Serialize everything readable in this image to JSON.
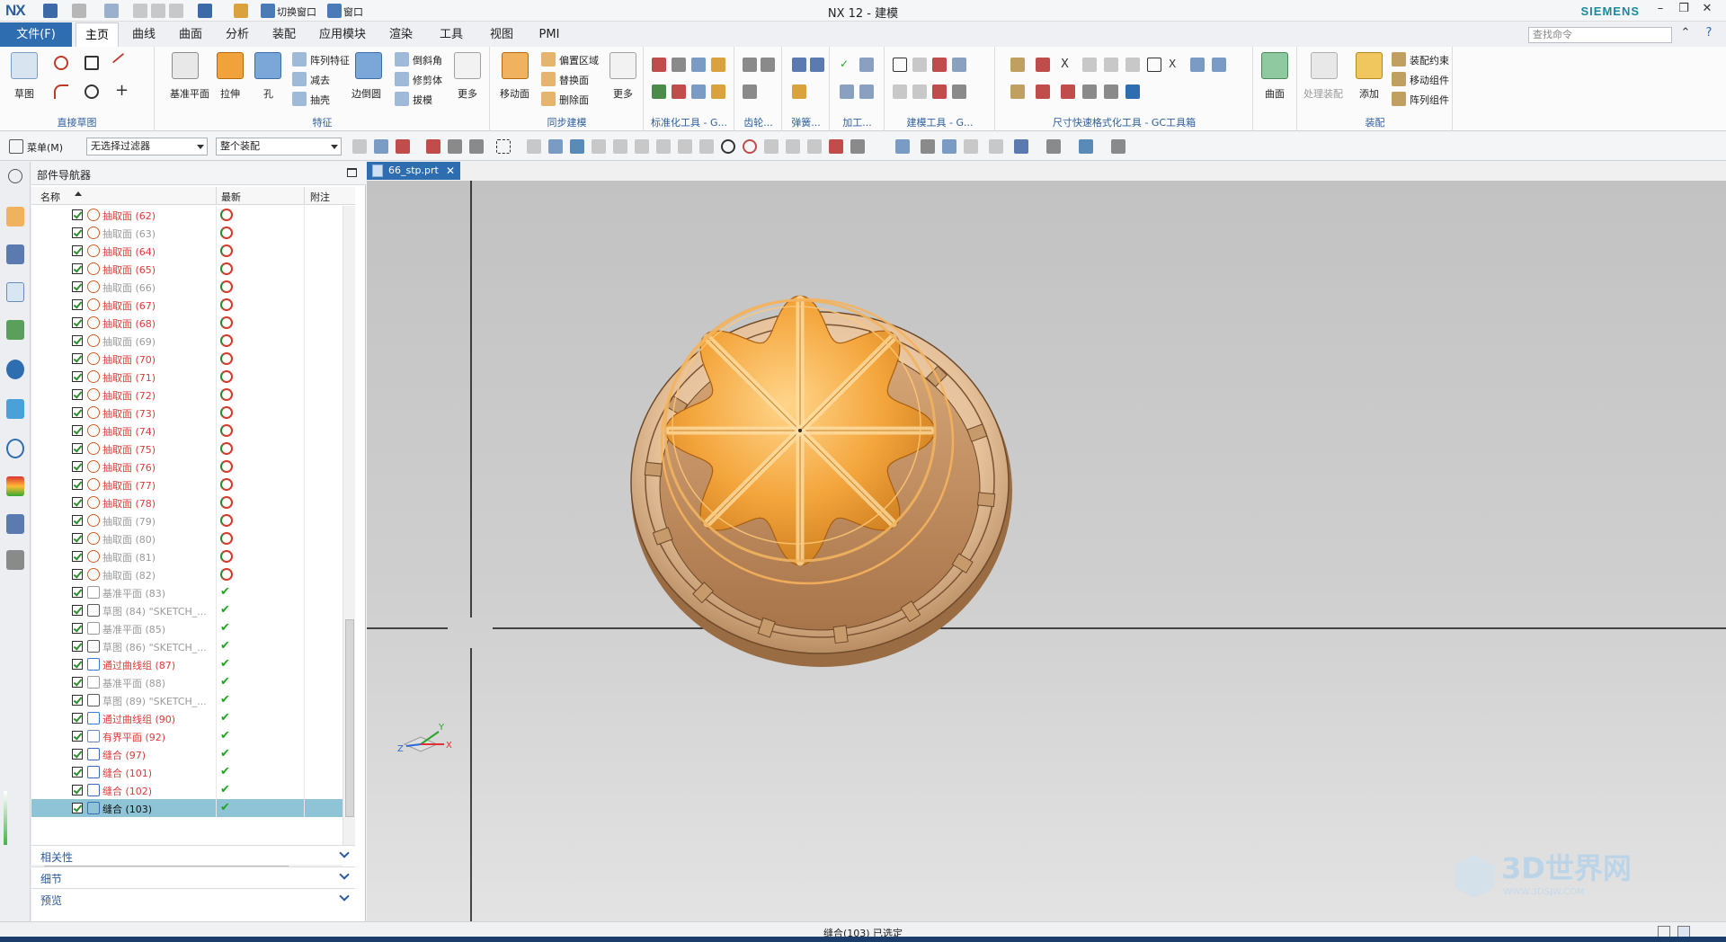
{
  "app": {
    "logo": "NX",
    "title": "NX 12 - 建模",
    "brand": "SIEMENS",
    "quick_access": {
      "switch_window": "切换窗口",
      "window": "窗口"
    }
  },
  "tabs": {
    "file": "文件(F)",
    "items": [
      "主页",
      "曲线",
      "曲面",
      "分析",
      "装配",
      "应用模块",
      "渲染",
      "工具",
      "视图",
      "PMI"
    ],
    "active_index": 0,
    "search_placeholder": "查找命令"
  },
  "ribbon": {
    "direct_sketch": {
      "label": "直接草图",
      "sketch": "草图"
    },
    "feature": {
      "label": "特征",
      "datum_plane": "基准平面",
      "extrude": "拉伸",
      "hole": "孔",
      "pattern_feature": "阵列特征",
      "subtract": "减去",
      "shell": "抽壳",
      "edge_blend": "边倒圆",
      "chamfer": "倒斜角",
      "trim_body": "修剪体",
      "draft": "拔模",
      "more": "更多"
    },
    "sync": {
      "label": "同步建模",
      "move_face": "移动面",
      "offset_region": "偏置区域",
      "replace_face": "替换面",
      "delete_face": "删除面",
      "more": "更多"
    },
    "standard_tools": "标准化工具 - G...",
    "gear": "齿轮...",
    "spring": "弹簧...",
    "machining": "加工...",
    "modeling_tools": "建模工具 - G...",
    "dimension": "尺寸快速格式化工具 - GC工具箱",
    "surface": "曲面",
    "assembly": {
      "label": "装配",
      "process": "处理装配",
      "add": "添加",
      "constraint": "装配约束",
      "move_component": "移动组件",
      "pattern_component": "阵列组件"
    }
  },
  "selection_bar": {
    "menu": "菜单(M)",
    "filter": "无选择过滤器",
    "scope": "整个装配"
  },
  "navigator": {
    "title": "部件导航器",
    "columns": [
      "名称",
      "最新",
      "附注"
    ],
    "rows": [
      {
        "name": "抽取面 (62)",
        "style": "red",
        "icon": "extract-face",
        "status": "update"
      },
      {
        "name": "抽取面 (63)",
        "style": "gray",
        "icon": "extract-face",
        "status": "update"
      },
      {
        "name": "抽取面 (64)",
        "style": "red",
        "icon": "extract-face",
        "status": "update"
      },
      {
        "name": "抽取面 (65)",
        "style": "red",
        "icon": "extract-face",
        "status": "update"
      },
      {
        "name": "抽取面 (66)",
        "style": "gray",
        "icon": "extract-face",
        "status": "update"
      },
      {
        "name": "抽取面 (67)",
        "style": "red",
        "icon": "extract-face",
        "status": "update"
      },
      {
        "name": "抽取面 (68)",
        "style": "red",
        "icon": "extract-face",
        "status": "update"
      },
      {
        "name": "抽取面 (69)",
        "style": "gray",
        "icon": "extract-face",
        "status": "update"
      },
      {
        "name": "抽取面 (70)",
        "style": "red",
        "icon": "extract-face",
        "status": "update"
      },
      {
        "name": "抽取面 (71)",
        "style": "red",
        "icon": "extract-face",
        "status": "update"
      },
      {
        "name": "抽取面 (72)",
        "style": "red",
        "icon": "extract-face",
        "status": "update"
      },
      {
        "name": "抽取面 (73)",
        "style": "red",
        "icon": "extract-face",
        "status": "update"
      },
      {
        "name": "抽取面 (74)",
        "style": "red",
        "icon": "extract-face",
        "status": "update"
      },
      {
        "name": "抽取面 (75)",
        "style": "red",
        "icon": "extract-face",
        "status": "update"
      },
      {
        "name": "抽取面 (76)",
        "style": "red",
        "icon": "extract-face",
        "status": "update"
      },
      {
        "name": "抽取面 (77)",
        "style": "red",
        "icon": "extract-face",
        "status": "update"
      },
      {
        "name": "抽取面 (78)",
        "style": "red",
        "icon": "extract-face",
        "status": "update"
      },
      {
        "name": "抽取面 (79)",
        "style": "gray",
        "icon": "extract-face",
        "status": "update"
      },
      {
        "name": "抽取面 (80)",
        "style": "gray",
        "icon": "extract-face",
        "status": "update"
      },
      {
        "name": "抽取面 (81)",
        "style": "gray",
        "icon": "extract-face",
        "status": "update"
      },
      {
        "name": "抽取面 (82)",
        "style": "gray",
        "icon": "extract-face",
        "status": "update"
      },
      {
        "name": "基准平面 (83)",
        "style": "gray",
        "icon": "datum-plane",
        "status": "ok"
      },
      {
        "name": "草图 (84) \"SKETCH_...",
        "style": "gray",
        "icon": "sketch",
        "status": "ok"
      },
      {
        "name": "基准平面 (85)",
        "style": "gray",
        "icon": "datum-plane",
        "status": "ok"
      },
      {
        "name": "草图 (86) \"SKETCH_...",
        "style": "gray",
        "icon": "sketch",
        "status": "ok"
      },
      {
        "name": "通过曲线组 (87)",
        "style": "red",
        "icon": "through-curves",
        "status": "ok"
      },
      {
        "name": "基准平面 (88)",
        "style": "gray",
        "icon": "datum-plane",
        "status": "ok"
      },
      {
        "name": "草图 (89) \"SKETCH_...",
        "style": "gray",
        "icon": "sketch",
        "status": "ok"
      },
      {
        "name": "通过曲线组 (90)",
        "style": "red",
        "icon": "through-curves",
        "status": "ok"
      },
      {
        "name": "有界平面 (92)",
        "style": "red",
        "icon": "bounded-plane",
        "status": "ok"
      },
      {
        "name": "缝合 (97)",
        "style": "red",
        "icon": "sew",
        "status": "ok"
      },
      {
        "name": "缝合 (101)",
        "style": "red",
        "icon": "sew",
        "status": "ok"
      },
      {
        "name": "缝合 (102)",
        "style": "red",
        "icon": "sew",
        "status": "ok"
      },
      {
        "name": "缝合 (103)",
        "style": "dark",
        "icon": "sew",
        "status": "ok",
        "selected": true
      }
    ],
    "panels": [
      "相关性",
      "细节",
      "预览"
    ]
  },
  "document_tab": {
    "name": "66_stp.prt"
  },
  "view": {
    "triad": {
      "x": "X",
      "y": "Y",
      "z": "Z"
    }
  },
  "status": {
    "message": "缝合(103) 已选定"
  },
  "watermark": {
    "text": "3D世界网",
    "sub": "WWW.3DSJW.COM"
  },
  "colors": {
    "accent": "#2e6db0",
    "model_orange": "#f2a23a",
    "model_base": "#e9c79f",
    "red_item": "#e03a3a"
  }
}
